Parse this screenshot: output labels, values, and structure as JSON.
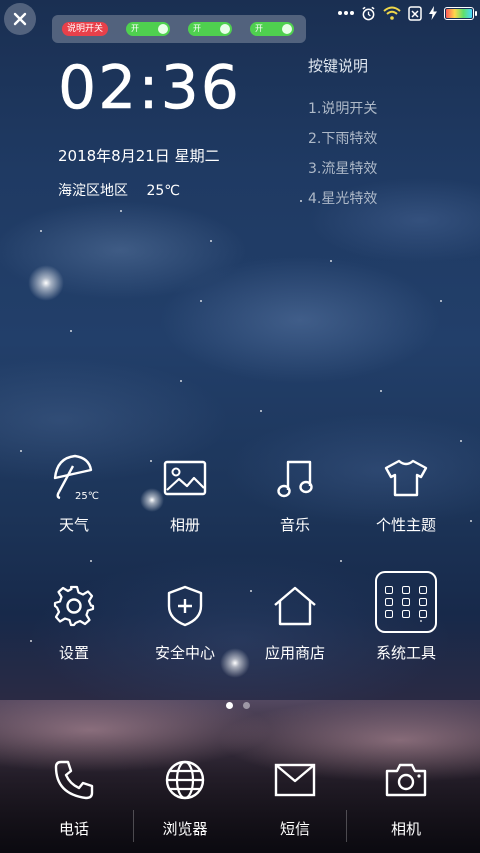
{
  "toggle_bar": {
    "explain_toggle": "说明开关",
    "switch_1": "开",
    "switch_2": "开",
    "switch_3": "开"
  },
  "status_bar": {
    "icons": [
      "more-dots-icon",
      "alarm-icon",
      "wifi-icon",
      "no-sim-icon",
      "charging-icon",
      "battery-icon"
    ]
  },
  "clock": {
    "time": "02:36",
    "date": "2018年8月21日 星期二",
    "district": "海淀区地区",
    "temperature": "25℃"
  },
  "help": {
    "title": "按键说明",
    "items": [
      "1.说明开关",
      "2.下雨特效",
      "3.流星特效",
      "4.星光特效"
    ]
  },
  "apps": {
    "weather": {
      "label": "天气",
      "temp": "25℃"
    },
    "album": {
      "label": "相册"
    },
    "music": {
      "label": "音乐"
    },
    "theme": {
      "label": "个性主题"
    },
    "settings": {
      "label": "设置"
    },
    "security": {
      "label": "安全中心"
    },
    "store": {
      "label": "应用商店"
    },
    "tools": {
      "label": "系统工具"
    }
  },
  "pager": {
    "pages": 2,
    "current": 1
  },
  "dock": {
    "phone": "电话",
    "browser": "浏览器",
    "messages": "短信",
    "camera": "相机"
  }
}
